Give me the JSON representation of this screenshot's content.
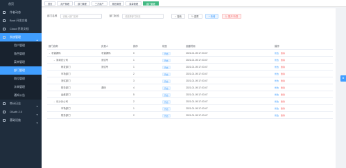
{
  "sidebar": {
    "items": [
      {
        "label": "首页",
        "level": "top"
      },
      {
        "label": "作者动态",
        "level": "item"
      },
      {
        "label": "Boot 开发文档",
        "level": "item"
      },
      {
        "label": "Cloud 开发文档",
        "level": "item"
      },
      {
        "label": "系统管理",
        "level": "item",
        "active": true,
        "expanded": true
      },
      {
        "label": "用户管理",
        "level": "sub"
      },
      {
        "label": "角色管理",
        "level": "sub"
      },
      {
        "label": "菜单管理",
        "level": "sub"
      },
      {
        "label": "部门管理",
        "level": "sub",
        "active": true
      },
      {
        "label": "岗位管理",
        "level": "sub"
      },
      {
        "label": "字典管理",
        "level": "sub"
      },
      {
        "label": "通知公告",
        "level": "sub"
      },
      {
        "label": "审计日志",
        "level": "item"
      },
      {
        "label": "OAuth 2.0",
        "level": "item"
      },
      {
        "label": "基础设施",
        "level": "item"
      }
    ]
  },
  "tags": [
    "首页",
    "用户管理",
    "部门管理",
    "三方用户",
    "角色管理",
    "菜单管理",
    "部门管理"
  ],
  "search": {
    "name_label": "部门名称",
    "name_placeholder": "请输入部门名称",
    "status_label": "部门状态",
    "status_placeholder": "请选择部门状态",
    "search_btn": "搜索",
    "reset_btn": "重置",
    "add_btn": "新增",
    "expand_btn": "展开/折叠"
  },
  "table": {
    "headers": [
      "部门名称",
      "负责人",
      "排序",
      "状态",
      "创建时间",
      "操作"
    ],
    "rows": [
      {
        "name": "芋道源码",
        "indent": 0,
        "toggle": "expanded",
        "leader": "芋道源码",
        "sort": "0",
        "status": "开启",
        "time": "2021-01-05 17:03:47"
      },
      {
        "name": "深圳总公司",
        "indent": 1,
        "toggle": "expanded",
        "leader": "测试号",
        "sort": "1",
        "status": "开启",
        "time": "2021-01-05 17:03:47"
      },
      {
        "name": "研发部门",
        "indent": 2,
        "toggle": "",
        "leader": "测试号",
        "sort": "1",
        "status": "开启",
        "time": "2021-01-05 17:03:47"
      },
      {
        "name": "市场部门",
        "indent": 2,
        "toggle": "",
        "leader": "",
        "sort": "2",
        "status": "开启",
        "time": "2021-01-05 17:03:47"
      },
      {
        "name": "测试部门",
        "indent": 2,
        "toggle": "",
        "leader": "",
        "sort": "3",
        "status": "开启",
        "time": "2021-01-05 17:03:47"
      },
      {
        "name": "财务部门",
        "indent": 2,
        "toggle": "",
        "leader": "源码",
        "sort": "4",
        "status": "开启",
        "time": "2021-01-05 17:03:47"
      },
      {
        "name": "运维部门",
        "indent": 2,
        "toggle": "",
        "leader": "",
        "sort": "5",
        "status": "开启",
        "time": "2021-01-05 17:03:47"
      },
      {
        "name": "长沙分公司",
        "indent": 1,
        "toggle": "expanded",
        "leader": "",
        "sort": "2",
        "status": "开启",
        "time": "2021-01-05 17:03:47"
      },
      {
        "name": "市场部门",
        "indent": 2,
        "toggle": "",
        "leader": "",
        "sort": "1",
        "status": "开启",
        "time": "2021-01-05 17:03:47"
      },
      {
        "name": "财务部门",
        "indent": 2,
        "toggle": "",
        "leader": "",
        "sort": "2",
        "status": "开启",
        "time": "2021-01-05 17:03:47"
      }
    ],
    "op_edit": "修改",
    "op_delete": "删除"
  },
  "colors": {
    "primary": "#409eff",
    "sidebar_bg": "#1f2d3d",
    "danger": "#f56c6c",
    "tag_active": "#42b983"
  }
}
